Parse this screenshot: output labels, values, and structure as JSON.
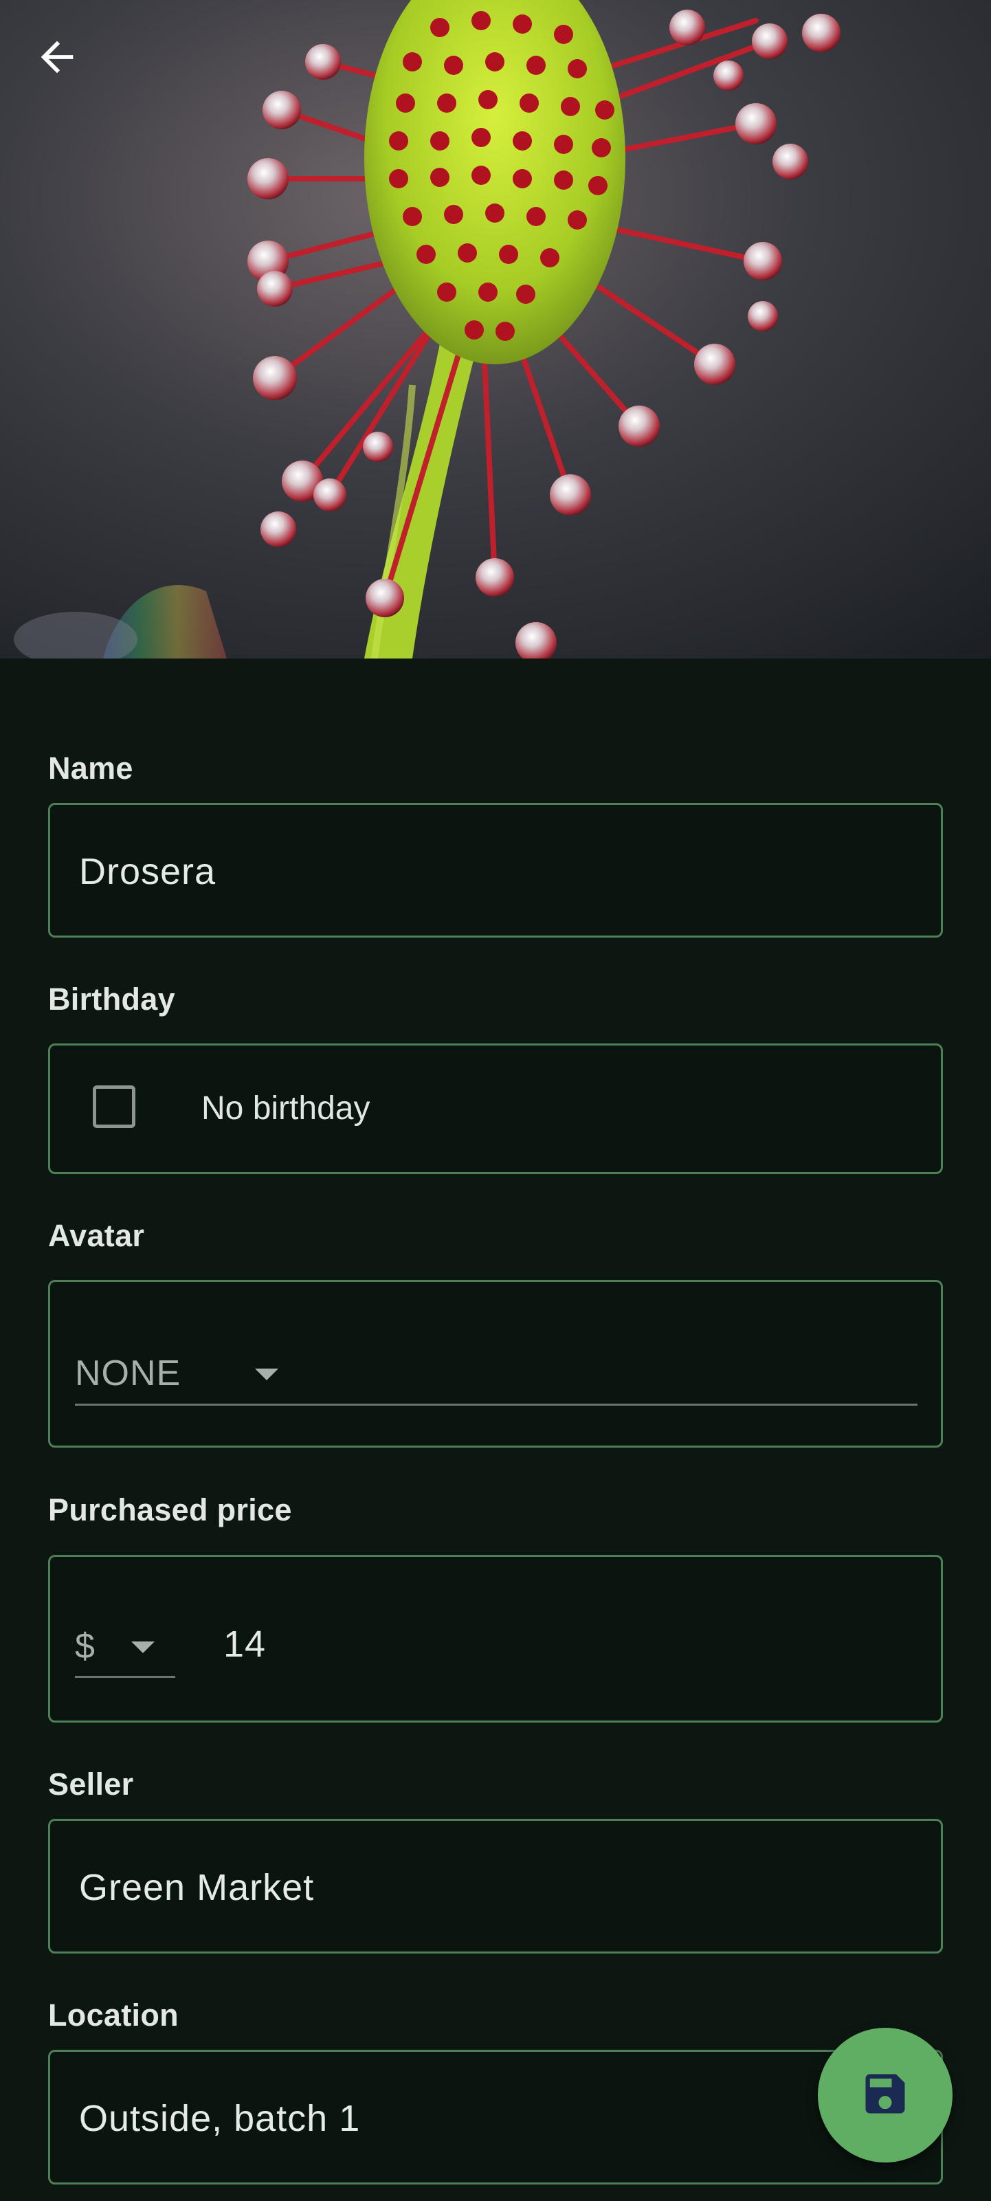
{
  "header": {
    "back_icon": "arrow-back-icon",
    "photo_description": "plant-photo"
  },
  "form": {
    "name": {
      "label": "Name",
      "value": "Drosera"
    },
    "birthday": {
      "label": "Birthday",
      "checkbox_label": "No birthday",
      "checked": false
    },
    "avatar": {
      "label": "Avatar",
      "selected": "NONE"
    },
    "purchased_price": {
      "label": "Purchased price",
      "currency": "$",
      "value": "14"
    },
    "seller": {
      "label": "Seller",
      "value": "Green Market"
    },
    "location": {
      "label": "Location",
      "value": "Outside, batch 1"
    }
  },
  "fab": {
    "icon": "save-icon"
  },
  "colors": {
    "background": "#0d1712",
    "field_border": "#4f7f57",
    "fab": "#5fae63",
    "fab_icon": "#1b2a52"
  }
}
